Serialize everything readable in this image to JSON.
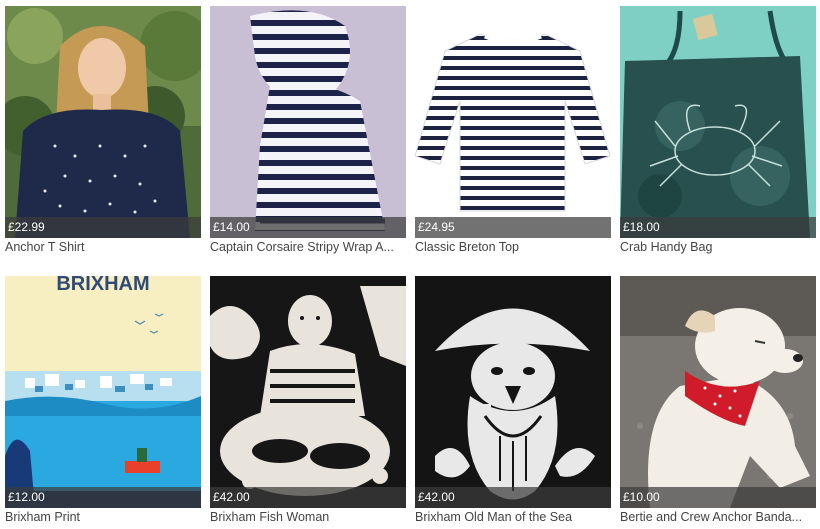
{
  "products": [
    {
      "price": "£22.99",
      "title": "Anchor T Shirt",
      "image": "woman-in-anchor-tshirt-photo"
    },
    {
      "price": "£14.00",
      "title": "Captain Corsaire Stripy Wrap A...",
      "image": "striped-scarf-photo"
    },
    {
      "price": "£24.95",
      "title": "Classic Breton Top",
      "image": "breton-striped-top-photo"
    },
    {
      "price": "£18.00",
      "title": "Crab Handy Bag",
      "image": "tie-dye-crab-tote-bag-photo"
    },
    {
      "price": "£12.00",
      "title": "Brixham Print",
      "image": "brixham-harbour-poster",
      "poster_text": "BRIXHAM"
    },
    {
      "price": "£42.00",
      "title": "Brixham Fish Woman",
      "image": "fish-woman-linocut"
    },
    {
      "price": "£42.00",
      "title": "Brixham Old Man of the Sea",
      "image": "old-man-of-the-sea-linocut"
    },
    {
      "price": "£10.00",
      "title": "Bertie and Crew Anchor Banda...",
      "image": "dog-with-red-bandana-photo"
    }
  ]
}
